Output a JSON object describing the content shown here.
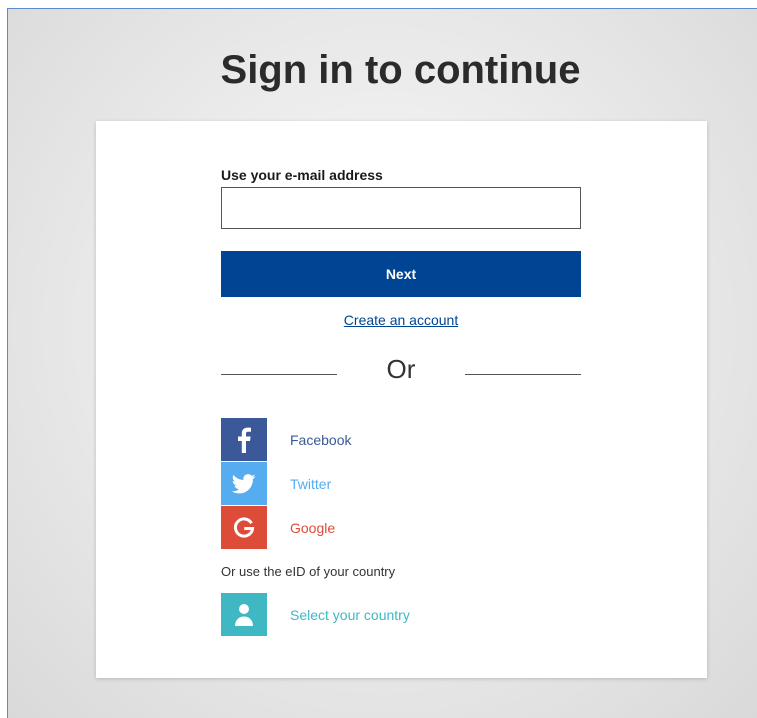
{
  "title": "Sign in to continue",
  "email": {
    "label": "Use your e-mail address",
    "value": "",
    "placeholder": ""
  },
  "next_label": "Next",
  "create_account_label": "Create an account",
  "divider_label": "Or",
  "social": {
    "facebook": {
      "label": "Facebook",
      "icon": "facebook-icon",
      "color": "#3b5998"
    },
    "twitter": {
      "label": "Twitter",
      "icon": "twitter-icon",
      "color": "#55acee"
    },
    "google": {
      "label": "Google",
      "icon": "google-icon",
      "color": "#dd4b39"
    }
  },
  "eid": {
    "text": "Or use the eID of your country",
    "select_label": "Select your country",
    "icon": "person-icon",
    "color": "#3fb8c4"
  },
  "colors": {
    "primary": "#004494",
    "background": "#e5e5e5",
    "frame_border": "#5b8bd0"
  }
}
